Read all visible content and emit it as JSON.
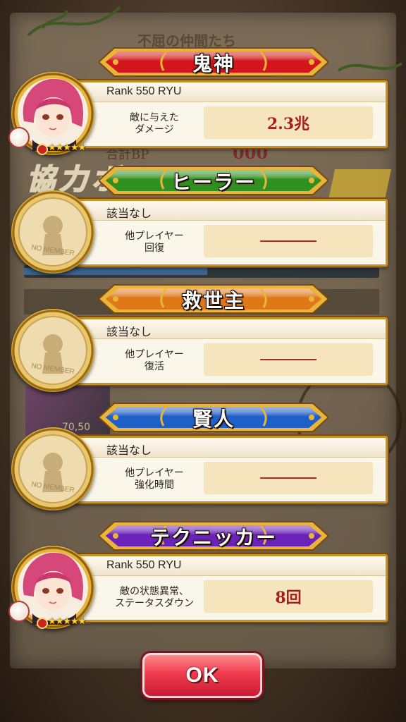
{
  "background": {
    "title": "不屈の仲間たち",
    "bp_label": "合計BP",
    "bp_value": "000",
    "banner_text": "協力ボーナス",
    "card_number": "70,50"
  },
  "categories": [
    {
      "id": "oni",
      "title": "鬼神",
      "color": "red",
      "player": "Rank 550 RYU",
      "metric_label": "敵に与えた\nダメージ",
      "value": "2.3兆",
      "has_member": true,
      "stars": "★★★★★"
    },
    {
      "id": "healer",
      "title": "ヒーラー",
      "color": "green",
      "player": "該当なし",
      "metric_label": "他プレイヤー\n回復",
      "value": "",
      "has_member": false
    },
    {
      "id": "savior",
      "title": "救世主",
      "color": "orange",
      "player": "該当なし",
      "metric_label": "他プレイヤー\n復活",
      "value": "",
      "has_member": false
    },
    {
      "id": "sage",
      "title": "賢人",
      "color": "blue",
      "player": "該当なし",
      "metric_label": "他プレイヤー\n強化時間",
      "value": "",
      "has_member": false
    },
    {
      "id": "technician",
      "title": "テクニッカー",
      "color": "purple",
      "player": "Rank 550 RYU",
      "metric_label": "敵の状態異常、\nステータスダウン",
      "value": "8回",
      "has_member": true,
      "stars": "★★★★★"
    }
  ],
  "no_member_label": "NO MEMBER",
  "ok_button": {
    "label": "OK"
  },
  "colors": {
    "red": "#d3161b",
    "green": "#2f8f1f",
    "orange": "#e07818",
    "blue": "#1f5fc8",
    "purple": "#6b22b8",
    "gold": "#e8b43a",
    "value_text": "#a51d1d"
  }
}
